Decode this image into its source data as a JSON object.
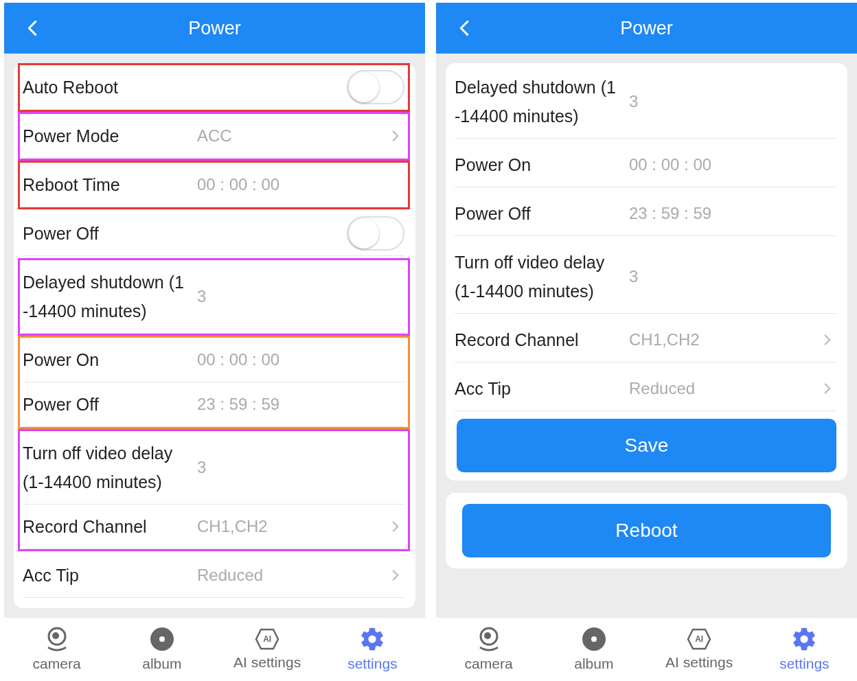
{
  "screens": [
    {
      "title": "Power",
      "groups": [
        {
          "color": "#e53935",
          "rows": [
            {
              "kind": "toggle",
              "label": "Auto Reboot",
              "on": false
            }
          ]
        },
        {
          "color": "#e040fb",
          "rows": [
            {
              "kind": "link",
              "label": "Power Mode",
              "value": "ACC"
            }
          ]
        },
        {
          "color": "#e53935",
          "rows": [
            {
              "kind": "value",
              "label": "Reboot Time",
              "value": "00 : 00 : 00"
            }
          ]
        },
        {
          "rows": [
            {
              "kind": "toggle",
              "label": "Power Off",
              "on": false
            }
          ]
        },
        {
          "color": "#e040fb",
          "rows": [
            {
              "kind": "value",
              "label": "Delayed shutdown (1\n-14400 minutes)",
              "value": "3"
            }
          ]
        },
        {
          "color": "#f0903c",
          "rows": [
            {
              "kind": "value",
              "label": "Power On",
              "value": "00 : 00 : 00"
            },
            {
              "kind": "value",
              "label": "Power Off",
              "value": "23 : 59 : 59"
            }
          ]
        },
        {
          "color": "#e040fb",
          "rows": [
            {
              "kind": "value",
              "label": "Turn off video delay\n(1-14400 minutes)",
              "value": "3"
            },
            {
              "kind": "link",
              "label": "Record Channel",
              "value": "CH1,CH2"
            }
          ]
        },
        {
          "rows": [
            {
              "kind": "link",
              "label": "Acc Tip",
              "value": "Reduced"
            }
          ]
        }
      ],
      "tabs": [
        {
          "kind": "camera",
          "label": "camera",
          "selected": false
        },
        {
          "kind": "album",
          "label": "album",
          "selected": false
        },
        {
          "kind": "ai",
          "label": "AI settings",
          "badge": "AI",
          "selected": false
        },
        {
          "kind": "gear",
          "label": "settings",
          "selected": true
        }
      ]
    },
    {
      "title": "Power",
      "groups": [
        {
          "rows": [
            {
              "kind": "value",
              "label": "Delayed shutdown (1\n-14400 minutes)",
              "value": "3"
            }
          ]
        },
        {
          "rows": [
            {
              "kind": "value",
              "label": "Power On",
              "value": "00 : 00 : 00"
            }
          ]
        },
        {
          "rows": [
            {
              "kind": "value",
              "label": "Power Off",
              "value": "23 : 59 : 59"
            }
          ]
        },
        {
          "rows": [
            {
              "kind": "value",
              "label": "Turn off video delay\n(1-14400 minutes)",
              "value": "3"
            }
          ]
        },
        {
          "rows": [
            {
              "kind": "link",
              "label": "Record Channel",
              "value": "CH1,CH2"
            }
          ]
        },
        {
          "rows": [
            {
              "kind": "link",
              "label": "Acc Tip",
              "value": "Reduced"
            }
          ]
        }
      ],
      "buttons": [
        "Save",
        "Reboot"
      ],
      "tabs": [
        {
          "kind": "camera",
          "label": "camera",
          "selected": false
        },
        {
          "kind": "album",
          "label": "album",
          "selected": false
        },
        {
          "kind": "ai",
          "label": "AI settings",
          "badge": "AI",
          "selected": false
        },
        {
          "kind": "gear",
          "label": "settings",
          "selected": true
        }
      ]
    }
  ]
}
